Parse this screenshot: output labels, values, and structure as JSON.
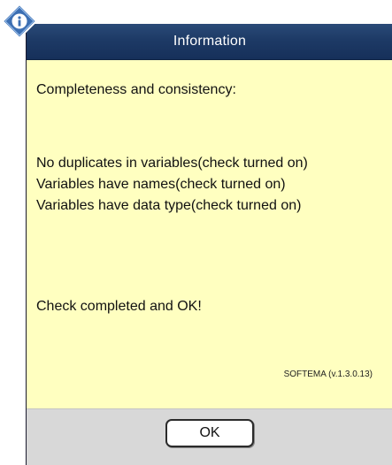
{
  "window": {
    "title": "Information"
  },
  "message": {
    "heading": "Completeness and consistency:",
    "checks": [
      "No duplicates in variables(check  turned on)",
      "Variables have names(check  turned on)",
      "Variables have data type(check  turned on)"
    ],
    "result": "Check completed and OK!",
    "version": "SOFTEMA (v.1.3.0.13)"
  },
  "buttons": {
    "ok_label": "OK"
  },
  "icons": {
    "info": "info-diamond-icon"
  },
  "colors": {
    "titlebar": "#1d3a66",
    "body_background": "#ffffc0",
    "footer_background": "#d8d8d8"
  }
}
